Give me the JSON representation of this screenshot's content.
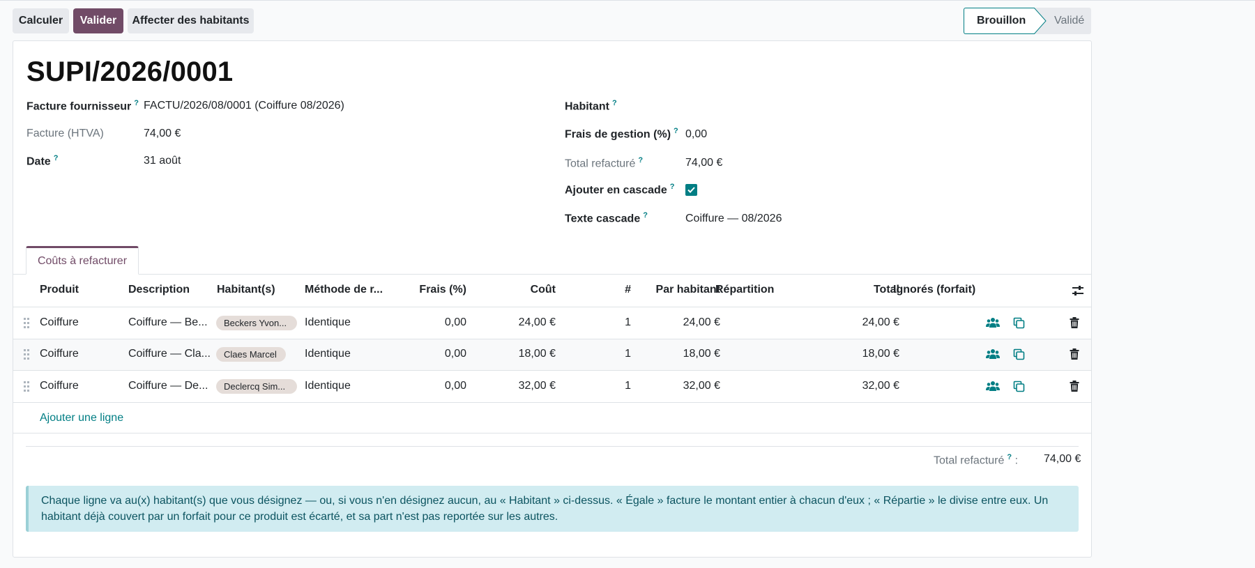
{
  "toolbar": {
    "calculer_label": "Calculer",
    "valider_label": "Valider",
    "affecter_label": "Affecter des habitants"
  },
  "statusbar": {
    "stages": [
      "Brouillon",
      "Validé"
    ],
    "active": "Brouillon"
  },
  "record": {
    "title": "SUPI/2026/0001",
    "left_fields": {
      "facture_fournisseur": {
        "label": "Facture fournisseur",
        "value": "FACTU/2026/08/0001 (Coiffure 08/2026)"
      },
      "facture_htva": {
        "label": "Facture (HTVA)",
        "value": "74,00 €"
      },
      "date": {
        "label": "Date",
        "value": "31 août"
      }
    },
    "right_fields": {
      "habitant": {
        "label": "Habitant",
        "value": ""
      },
      "frais_gestion": {
        "label": "Frais de gestion (%)",
        "value": "0,00"
      },
      "total_refacture": {
        "label": "Total refacturé",
        "value": "74,00 €"
      },
      "ajouter_cascade": {
        "label": "Ajouter en cascade",
        "checked": true
      },
      "texte_cascade": {
        "label": "Texte cascade",
        "value": "Coiffure — 08/2026"
      }
    },
    "help_mark": "?"
  },
  "tabs": [
    {
      "label": "Coûts à refacturer",
      "active": true
    }
  ],
  "table": {
    "headers": {
      "produit": "Produit",
      "description": "Description",
      "habitants": "Habitant(s)",
      "methode": "Méthode de r...",
      "frais": "Frais (%)",
      "cout": "Coût",
      "count": "#",
      "par_habitant": "Par habitant",
      "repartition": "Répartition",
      "total": "Total",
      "ignores": "Ignorés (forfait)"
    },
    "rows": [
      {
        "produit": "Coiffure",
        "description": "Coiffure — Be...",
        "habitant": "Beckers Yvon...",
        "methode": "Identique",
        "frais": "0,00",
        "cout": "24,00 €",
        "count": "1",
        "par_habitant": "24,00 €",
        "total": "24,00 €"
      },
      {
        "produit": "Coiffure",
        "description": "Coiffure — Cla...",
        "habitant": "Claes Marcel",
        "methode": "Identique",
        "frais": "0,00",
        "cout": "18,00 €",
        "count": "1",
        "par_habitant": "18,00 €",
        "total": "18,00 €"
      },
      {
        "produit": "Coiffure",
        "description": "Coiffure — De...",
        "habitant": "Declercq Sim...",
        "methode": "Identique",
        "frais": "0,00",
        "cout": "32,00 €",
        "count": "1",
        "par_habitant": "32,00 €",
        "total": "32,00 €"
      }
    ],
    "add_line_label": "Ajouter une ligne"
  },
  "footer_total": {
    "label": "Total refacturé",
    "suffix": " :",
    "value": "74,00 €"
  },
  "alert": {
    "text": "Chaque ligne va au(x) habitant(s) que vous désignez — ou, si vous n'en désignez aucun, au « Habitant » ci-dessus. « Égale » facture le montant entier à chacun d'eux ; « Répartie » le divise entre eux. Un habitant déjà couvert par un forfait pour ce produit est écarté, et sa part n'est pas reportée sur les autres."
  },
  "colors": {
    "primary": "#714b67",
    "accent": "#017e84",
    "alert_bg": "#d1ecf1"
  },
  "icons": [
    "drag-handle-icon",
    "users-icon",
    "duplicate-icon",
    "trash-icon",
    "settings-sliders-icon",
    "check-icon"
  ]
}
